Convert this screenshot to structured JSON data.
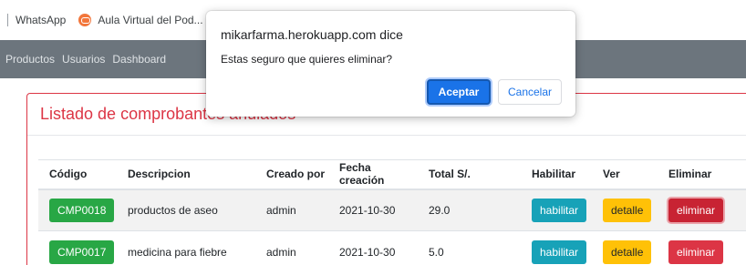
{
  "bookmarks": [
    {
      "label": "WhatsApp",
      "icon": "whatsapp-icon"
    },
    {
      "label": "Aula Virtual del Pod...",
      "icon": "aula-virtual-icon"
    }
  ],
  "navbar": {
    "links": [
      "Productos",
      "Usuarios",
      "Dashboard"
    ]
  },
  "card": {
    "title": "Listado de comprobantes anulados",
    "accent_color": "#dc3545"
  },
  "table": {
    "headers": [
      "Código",
      "Descripcion",
      "Creado por",
      "Fecha creación",
      "Total S/.",
      "Habilitar",
      "Ver",
      "Eliminar"
    ],
    "rows": [
      {
        "codigo": "CMP0018",
        "descripcion": "productos de aseo",
        "creado_por": "admin",
        "fecha": "2021-10-30",
        "total": "29.0",
        "habilitar": "habilitar",
        "ver": "detalle",
        "eliminar": "eliminar"
      },
      {
        "codigo": "CMP0017",
        "descripcion": "medicina para fiebre",
        "creado_por": "admin",
        "fecha": "2021-10-30",
        "total": "5.0",
        "habilitar": "habilitar",
        "ver": "detalle",
        "eliminar": "eliminar"
      }
    ]
  },
  "dialog": {
    "title": "mikarfarma.herokuapp.com dice",
    "message": "Estas seguro que quieres eliminar?",
    "ok_label": "Aceptar",
    "cancel_label": "Cancelar"
  }
}
